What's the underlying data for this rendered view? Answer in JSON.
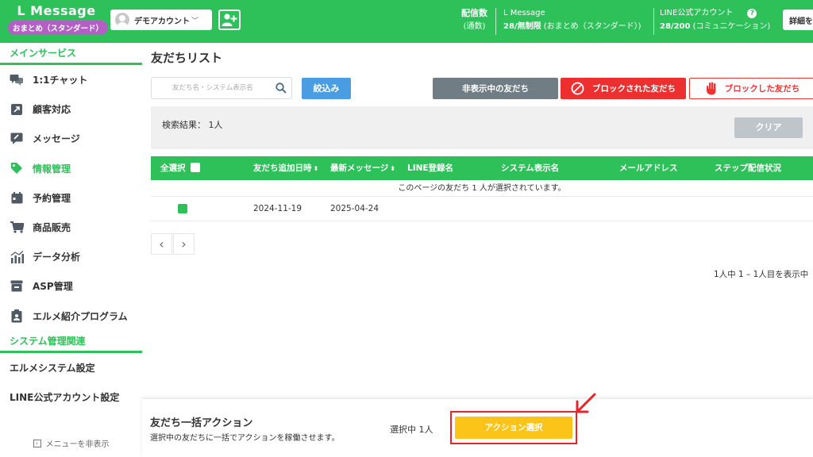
{
  "header": {
    "brand": "L Message",
    "plan_badge": "おまとめ（スタンダード）",
    "account_name": "デモアカウント",
    "stats": {
      "delivery_label": "配信数",
      "delivery_sub": "(通数)",
      "lmessage_title": "L Message",
      "lmessage_value": "28/無制限",
      "lmessage_plan": "(おまとめ（スタンダード）)",
      "line_title": "LINE公式アカウント",
      "line_value": "28/200",
      "line_plan": "(コミュニケーション)"
    },
    "help_glyph": "?",
    "detail_label": "詳細を"
  },
  "sidebar": {
    "main_section": "メインサービス",
    "items": [
      {
        "label": "1:1チャット",
        "icon": "chat-icon"
      },
      {
        "label": "顧客対応",
        "icon": "expand-arrow-icon"
      },
      {
        "label": "メッセージ",
        "icon": "message-edit-icon"
      },
      {
        "label": "情報管理",
        "icon": "tag-icon"
      },
      {
        "label": "予約管理",
        "icon": "calendar-icon"
      },
      {
        "label": "商品販売",
        "icon": "cart-icon"
      },
      {
        "label": "データ分析",
        "icon": "analytics-icon"
      },
      {
        "label": "ASP管理",
        "icon": "asp-icon"
      },
      {
        "label": "エルメ紹介プログラム",
        "icon": "badge-icon"
      }
    ],
    "active_item": "情報管理",
    "system_section": "システム管理関連",
    "system_items": [
      "エルメシステム設定",
      "LINE公式アカウント設定"
    ],
    "hide_menu": "メニューを非表示"
  },
  "main": {
    "page_title": "友だちリスト",
    "search_placeholder": "友だち名・システム表示名",
    "filter_label": "絞込み",
    "tabs": {
      "hidden": "非表示中の友だち",
      "blocked": "ブロックされた友だち",
      "blocking": "ブロックした友だち"
    },
    "result_label": "検索結果： 1人",
    "clear_label": "クリア",
    "table": {
      "headers": {
        "select_all": "全選択",
        "added_at": "友だち追加日時",
        "latest_message": "最新メッセージ",
        "line_name": "LINE登録名",
        "system_name": "システム表示名",
        "email": "メールアドレス",
        "step_status": "ステップ配信状況"
      },
      "selection_notice": "このページの友だち 1 人が選択されています。",
      "rows": [
        {
          "added_at": "2024-11-19",
          "latest_message": "2025-04-24",
          "line_name": "",
          "system_name": "",
          "email": "",
          "step_status": ""
        }
      ]
    },
    "pager": {
      "prev": "‹",
      "next": "›"
    },
    "page_info": "1人中 1 – 1人目を表示中"
  },
  "bottom_bar": {
    "title": "友だち一括アクション",
    "description": "選択中の友だちに一括でアクションを稼働させます。",
    "selected_count": "選択中 1人",
    "action_label": "アクション選択"
  },
  "colors": {
    "brand_green": "#2ec15a",
    "filter_blue": "#4a9de1",
    "hidden_gray": "#717d85",
    "blocked_red": "#ed2f2f",
    "action_yellow": "#fcc419",
    "badge_purple": "#b35fc6",
    "highlight_red": "#e8232a"
  }
}
